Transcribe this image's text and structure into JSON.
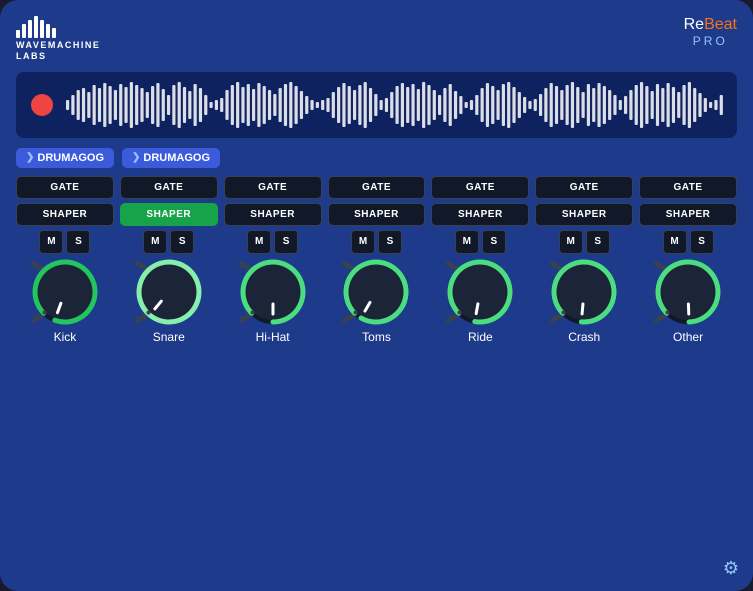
{
  "app": {
    "title": "ReBeat PRO",
    "brand": "WAVEMACHINE\nLABS",
    "record_label": "●"
  },
  "header": {
    "logo_text_line1": "WAVEMACHINE",
    "logo_text_line2": "LABS",
    "rebeat_re": "Re",
    "rebeat_beat": "Beat",
    "rebeat_pro": "PRO"
  },
  "drumagog_buttons": [
    {
      "label": "DRUMAGOG",
      "arrow": "❯"
    },
    {
      "label": "DRUMAGOG",
      "arrow": "❯"
    }
  ],
  "channels": [
    {
      "name": "Kick",
      "gate": "GATE",
      "shaper": "SHAPER",
      "shaper_active": false,
      "mute": "M",
      "solo": "S",
      "knob_angle": 200,
      "knob_color": "#22c55e",
      "knob_trail_color": "#22c55e"
    },
    {
      "name": "Snare",
      "gate": "GATE",
      "shaper": "SHAPER",
      "shaper_active": true,
      "mute": "M",
      "solo": "S",
      "knob_angle": 220,
      "knob_color": "#86efac",
      "knob_trail_color": "#f97316"
    },
    {
      "name": "Hi-Hat",
      "gate": "GATE",
      "shaper": "SHAPER",
      "shaper_active": false,
      "mute": "M",
      "solo": "S",
      "knob_angle": 180,
      "knob_color": "#4ade80",
      "knob_trail_color": "#4ade80"
    },
    {
      "name": "Toms",
      "gate": "GATE",
      "shaper": "SHAPER",
      "shaper_active": false,
      "mute": "M",
      "solo": "S",
      "knob_angle": 210,
      "knob_color": "#4ade80",
      "knob_trail_color": "#4ade80"
    },
    {
      "name": "Ride",
      "gate": "GATE",
      "shaper": "SHAPER",
      "shaper_active": false,
      "mute": "M",
      "solo": "S",
      "knob_angle": 190,
      "knob_color": "#4ade80",
      "knob_trail_color": "#4ade80"
    },
    {
      "name": "Crash",
      "gate": "GATE",
      "shaper": "SHAPER",
      "shaper_active": false,
      "mute": "M",
      "solo": "S",
      "knob_angle": 185,
      "knob_color": "#4ade80",
      "knob_trail_color": "#4ade80"
    },
    {
      "name": "Other",
      "gate": "GATE",
      "shaper": "SHAPER",
      "shaper_active": false,
      "mute": "M",
      "solo": "S",
      "knob_angle": 178,
      "knob_color": "#4ade80",
      "knob_trail_color": "#4ade80"
    }
  ],
  "settings_icon": "⚙"
}
